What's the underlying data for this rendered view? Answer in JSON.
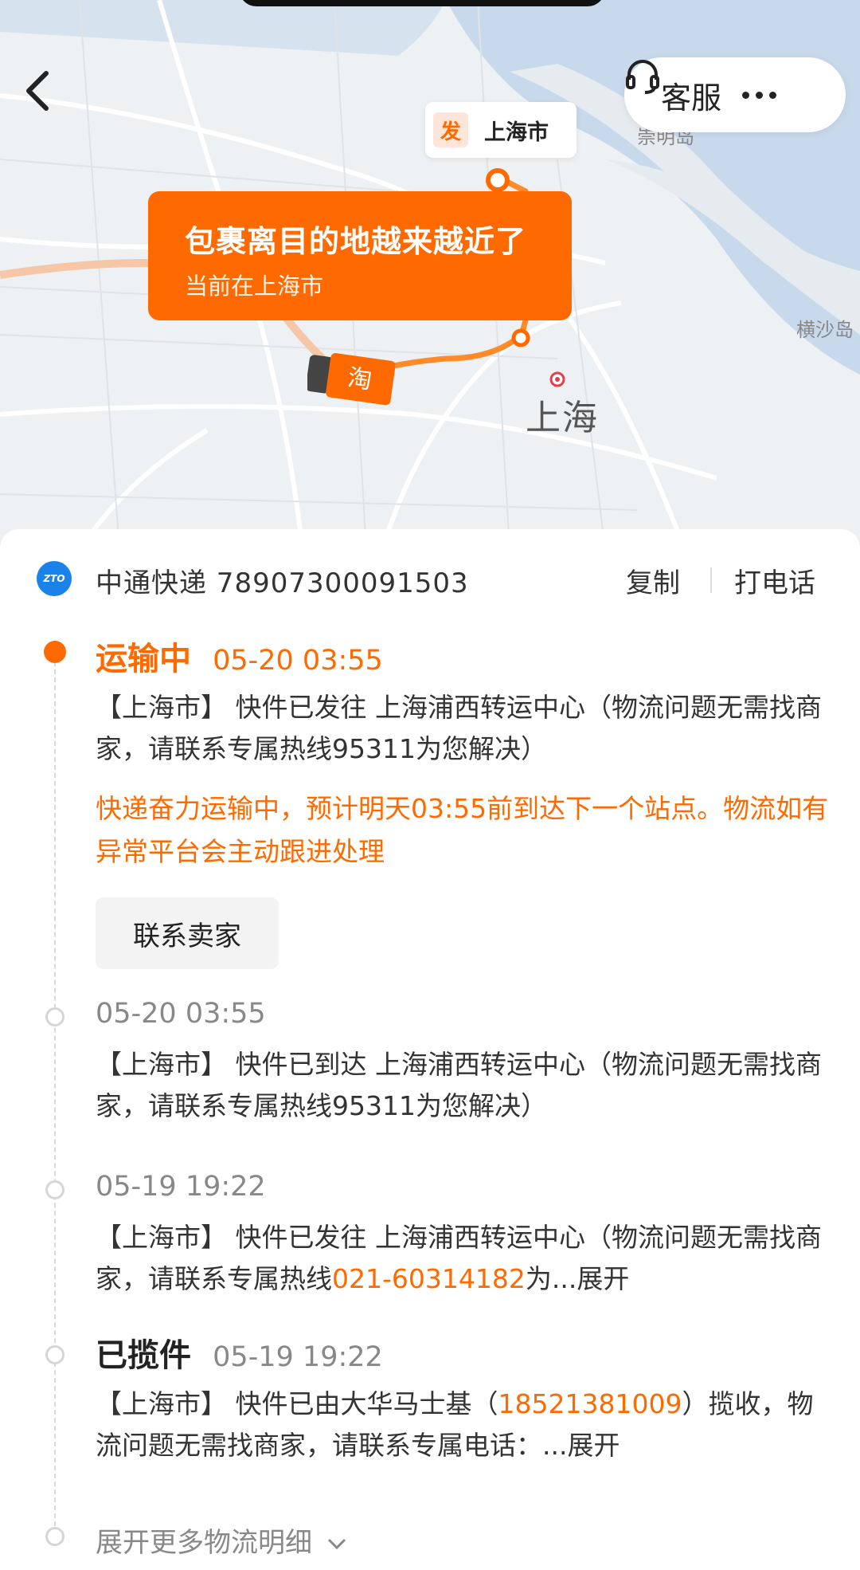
{
  "header": {
    "service_label": "客服",
    "back_icon": "chevron-left-icon",
    "service_icon": "headset-icon",
    "more_icon": "more-dots-icon"
  },
  "map": {
    "origin_badge": "发",
    "origin_city": "上海市",
    "bubble_title": "包裹离目的地越来越近了",
    "bubble_subtitle": "当前在上海市",
    "city_label": "上海",
    "place_top": "崇明岛",
    "place_right": "横沙岛",
    "truck_badge": "淘",
    "route_color": "#ff6a00"
  },
  "carrier": {
    "logo_text": "ZTO",
    "info": "中通快递 78907300091503",
    "copy_label": "复制",
    "call_label": "打电话"
  },
  "timeline": {
    "current": {
      "status": "运输中",
      "time": "05-20 03:55",
      "desc": "【上海市】 快件已发往 上海浦西转运中心（物流问题无需找商家，请联系专属热线95311为您解决）",
      "notice": "快递奋力运输中，预计明天03:55前到达下一个站点。物流如有异常平台会主动跟进处理",
      "contact_label": "联系卖家"
    },
    "event2": {
      "time": "05-20 03:55",
      "desc": "【上海市】 快件已到达 上海浦西转运中心（物流问题无需找商家，请联系专属热线95311为您解决）"
    },
    "event3": {
      "time": "05-19 19:22",
      "desc_prefix": "【上海市】 快件已发往 上海浦西转运中心（物流问题无需找商家，请联系专属热线",
      "phone": "021-60314182",
      "desc_suffix": "为...展开"
    },
    "event4": {
      "status": "已揽件",
      "time": "05-19 19:22",
      "desc_prefix": "【上海市】 快件已由大华马士基（",
      "phone": "18521381009",
      "desc_suffix": "）揽收，物流问题无需找商家，请联系专属电话：...展开"
    },
    "expand_label": "展开更多物流明细"
  },
  "colors": {
    "accent": "#ff6a00",
    "carrier_blue": "#1a82e8"
  }
}
